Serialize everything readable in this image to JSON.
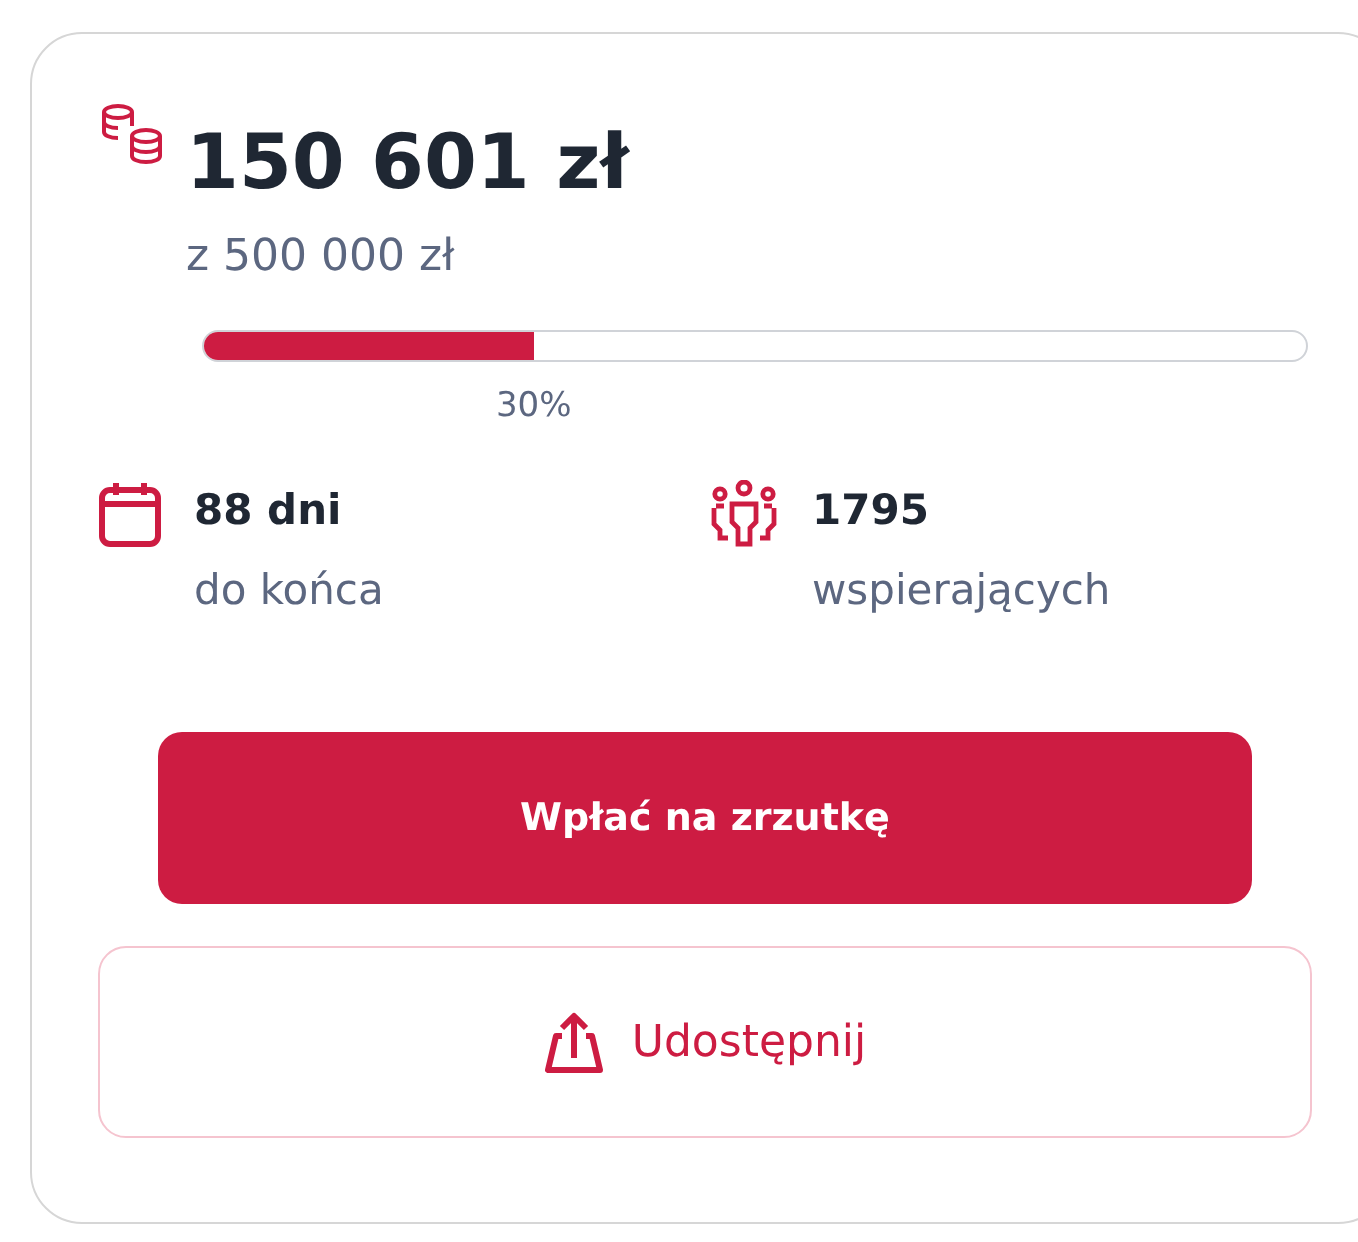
{
  "raised": {
    "amount": "150 601 zł",
    "goal": "z 500 000 zł"
  },
  "progress": {
    "level": 0.3,
    "label": "30%"
  },
  "stats": [
    {
      "kind": "days",
      "value": "88 dni",
      "caption": "do końca"
    },
    {
      "kind": "supporters",
      "value": "1795",
      "caption": "wspierających"
    }
  ],
  "donate_button": {
    "label": "Wpłać na zrzutkę"
  },
  "share_button": {
    "label": "Udostępnij"
  }
}
